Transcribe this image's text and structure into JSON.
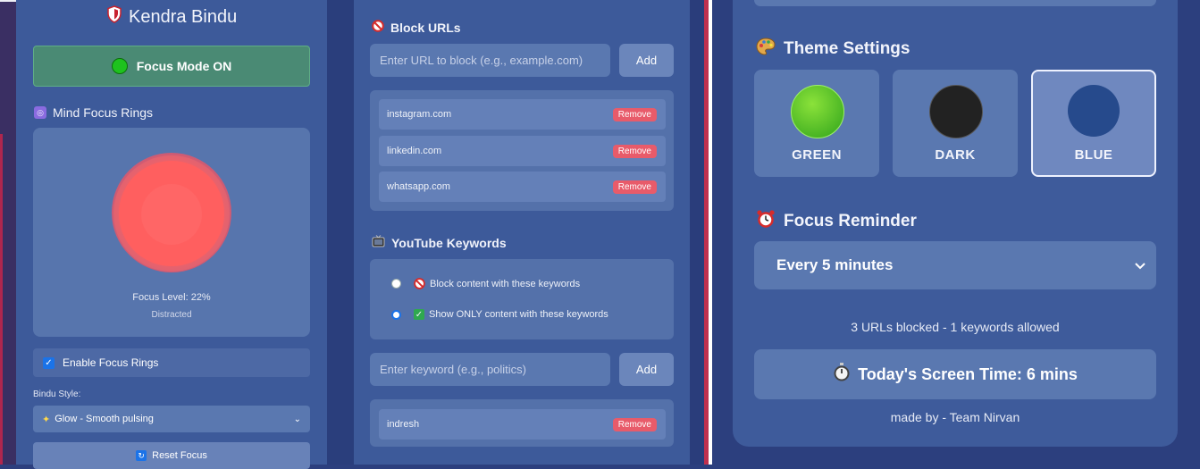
{
  "colors": {
    "panel": "#3d5a9a",
    "focus_on_bg": "#4a8a74",
    "remove_btn": "#e85b6a",
    "ring": "#ff6666",
    "theme_green": "#3fbf22",
    "theme_dark": "#222222",
    "theme_blue": "#264a8c"
  },
  "left_panel": {
    "brand_name": "Kendra Bindu",
    "brand_icon": "shield-icon",
    "focus_mode_label": "Focus Mode ON",
    "rings_title": "Mind Focus Rings",
    "focus_level": "Focus Level: 22%",
    "focus_state": "Distracted",
    "enable_rings_label": "Enable Focus Rings",
    "enable_rings_checked": true,
    "bindu_style_label": "Bindu Style:",
    "bindu_style_value": "Glow - Smooth pulsing",
    "reset_label": "Reset Focus"
  },
  "middle_panel": {
    "block_urls_title": "Block URLs",
    "url_input_placeholder": "Enter URL to block (e.g., example.com)",
    "add_label": "Add",
    "blocked_urls": [
      "instagram.com",
      "linkedin.com",
      "whatsapp.com"
    ],
    "remove_label": "Remove",
    "youtube_title": "YouTube Keywords",
    "radio_block_label": "Block content with these keywords",
    "radio_only_label": "Show ONLY content with these keywords",
    "keyword_input_placeholder": "Enter keyword (e.g., politics)",
    "keywords": [
      "indresh"
    ]
  },
  "right_panel": {
    "theme_title": "Theme Settings",
    "themes": [
      {
        "label": "GREEN",
        "active": false
      },
      {
        "label": "DARK",
        "active": false
      },
      {
        "label": "BLUE",
        "active": true
      }
    ],
    "reminder_title": "Focus Reminder",
    "reminder_value": "Every 5 minutes",
    "stats": "3 URLs blocked - 1 keywords allowed",
    "screen_time": "Today's Screen Time: 6 mins",
    "made_by": "made by - Team Nirvan"
  }
}
